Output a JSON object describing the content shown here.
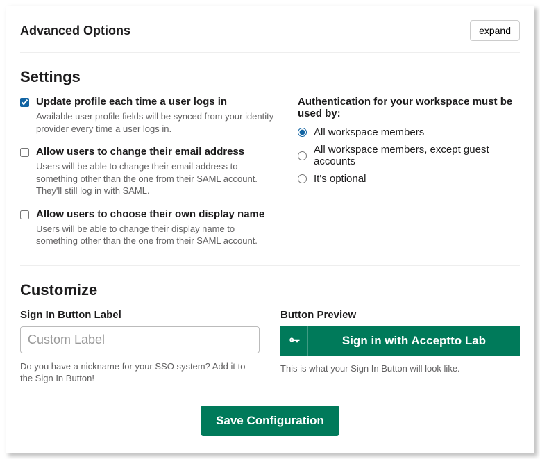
{
  "advanced": {
    "title": "Advanced Options",
    "expand_label": "expand"
  },
  "settings": {
    "title": "Settings",
    "checkboxes": [
      {
        "label": "Update profile each time a user logs in",
        "desc": "Available user profile fields will be synced from your identity provider every time a user logs in.",
        "checked": true
      },
      {
        "label": "Allow users to change their email address",
        "desc": "Users will be able to change their email address to something other than the one from their SAML account. They'll still log in with SAML.",
        "checked": false
      },
      {
        "label": "Allow users to choose their own display name",
        "desc": "Users will be able to change their display name to something other than the one from their SAML account.",
        "checked": false
      }
    ],
    "auth_heading": "Authentication for your workspace must be used by:",
    "auth_options": [
      {
        "label": "All workspace members",
        "checked": true
      },
      {
        "label": "All workspace members, except guest accounts",
        "checked": false
      },
      {
        "label": "It's optional",
        "checked": false
      }
    ]
  },
  "customize": {
    "title": "Customize",
    "label_field": "Sign In Button Label",
    "placeholder": "Custom Label",
    "helper": "Do you have a nickname for your SSO system? Add it to the Sign In Button!",
    "preview_field": "Button Preview",
    "preview_button": "Sign in with Acceptto Lab",
    "preview_helper": "This is what your Sign In Button will look like."
  },
  "save_label": "Save Configuration"
}
